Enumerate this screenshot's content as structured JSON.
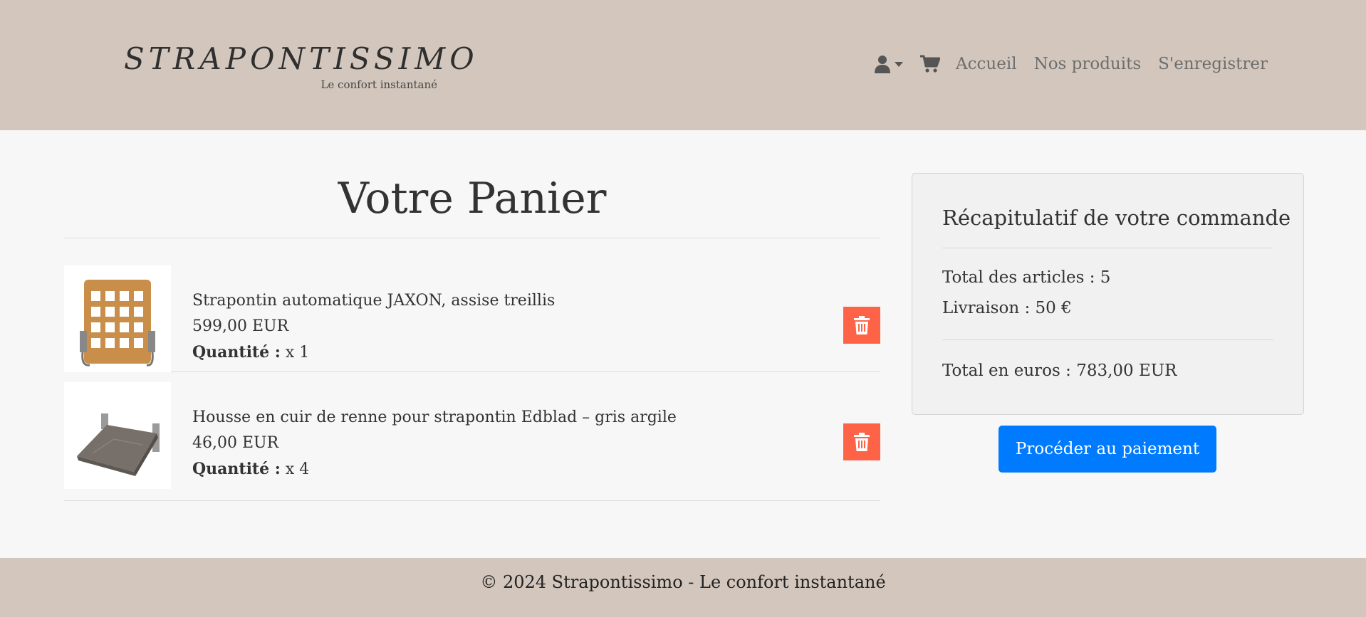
{
  "brand": {
    "name": "STRAPONTISSIMO",
    "tagline": "Le confort instantané"
  },
  "nav": {
    "icons": [
      "user-icon",
      "cart-icon"
    ],
    "links": [
      "Accueil",
      "Nos produits",
      "S'enregistrer"
    ]
  },
  "cart": {
    "title": "Votre Panier",
    "quantity_label": "Quantité :",
    "items": [
      {
        "name": "Strapontin automatique JAXON, assise treillis",
        "price": "599,00 EUR",
        "quantity": "x 1"
      },
      {
        "name": "Housse en cuir de renne pour strapontin Edblad – gris argile",
        "price": "46,00 EUR",
        "quantity": "x 4"
      }
    ]
  },
  "summary": {
    "title": "Récapitulatif de votre commande",
    "total_items": "Total des articles : 5",
    "shipping": "Livraison : 50 €",
    "total": "Total en euros : 783,00 EUR",
    "pay_button": "Procéder au paiement"
  },
  "footer": {
    "text": "© 2024 Strapontissimo - Le confort instantané"
  },
  "colors": {
    "header_bg": "#d3c7bd",
    "delete_button": "#ff6347",
    "pay_button": "#007bff"
  }
}
